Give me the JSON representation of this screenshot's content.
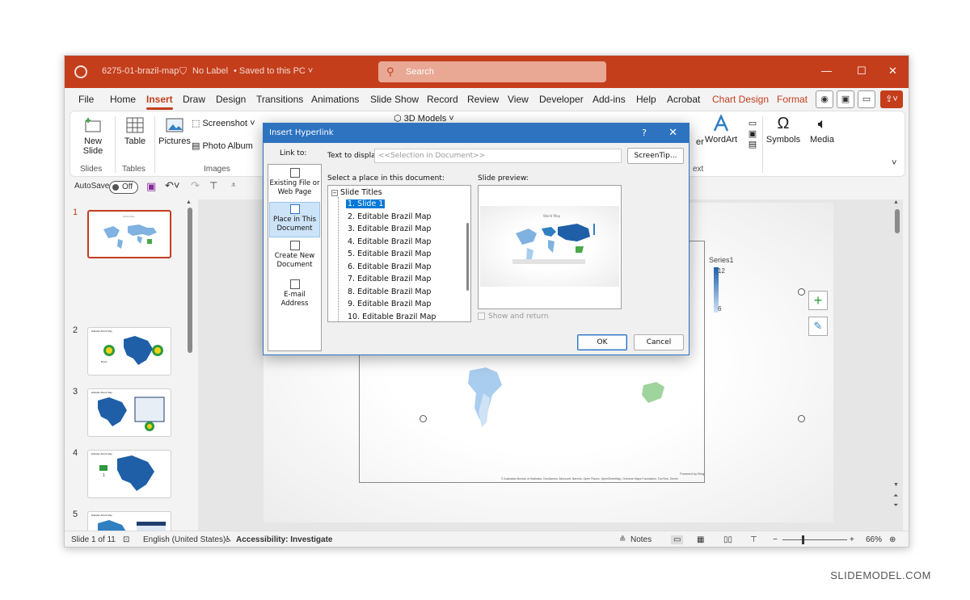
{
  "titlebar": {
    "filename": "6275-01-brazil-map",
    "label": "No Label",
    "saved": "Saved to this PC",
    "search_placeholder": "Search",
    "minimize": "—",
    "maximize": "☐",
    "close": "✕"
  },
  "tabs": [
    "File",
    "Home",
    "Insert",
    "Draw",
    "Design",
    "Transitions",
    "Animations",
    "Slide Show",
    "Record",
    "Review",
    "View",
    "Developer",
    "Add-ins",
    "Help",
    "Acrobat",
    "Chart Design",
    "Format"
  ],
  "active_tab": "Insert",
  "ribbon": {
    "new_slide": "New Slide",
    "table": "Table",
    "pictures": "Pictures",
    "screenshot": "Screenshot",
    "photo_album": "Photo Album",
    "models_3d": "3D Models",
    "wordart": "WordArt",
    "symbols": "Symbols",
    "media": "Media",
    "group_slides": "Slides",
    "group_tables": "Tables",
    "group_images": "Images",
    "partial_er": "er",
    "partial_ext": "ext"
  },
  "qat": {
    "autosave": "AutoSave",
    "autosave_state": "Off"
  },
  "thumbnails": [
    {
      "num": "1",
      "title": ""
    },
    {
      "num": "2",
      "title": "Editable Brazil Map"
    },
    {
      "num": "3",
      "title": "Editable Brazil Map"
    },
    {
      "num": "4",
      "title": "Editable Brazil Map"
    },
    {
      "num": "5",
      "title": "Editable Brazil Map"
    },
    {
      "num": "6",
      "title": ""
    }
  ],
  "thumb_extras": {
    "t1_title": "World Map",
    "t2_caption": "Brazil",
    "t4_num": "1"
  },
  "slide": {
    "legend_title": "Series1",
    "legend_max": "12",
    "legend_min": "6",
    "powered_by": "Powered by Bing",
    "attribution": "© Australian Bureau of Statistics, GeoNames, Microsoft, Navinfo, Open Places, OpenStreetMap, Overture Maps Foundation, TomTom, Zenrin"
  },
  "statusbar": {
    "slide_count": "Slide 1 of 11",
    "language": "English (United States)",
    "accessibility": "Accessibility: Investigate",
    "notes": "Notes",
    "zoom": "66%"
  },
  "dialog": {
    "title": "Insert Hyperlink",
    "help": "?",
    "close": "✕",
    "link_to": "Link to:",
    "link_options": [
      "Existing File or Web Page",
      "Place in This Document",
      "Create New Document",
      "E-mail Address"
    ],
    "text_to_display_label": "Text to display:",
    "text_to_display_value": "<<Selection in Document>>",
    "screentip": "ScreenTip...",
    "select_place_label": "Select a place in this document:",
    "slide_preview_label": "Slide preview:",
    "tree_root": "Slide Titles",
    "tree_items": [
      "1. Slide 1",
      "2. Editable Brazil Map",
      "3. Editable Brazil Map",
      "4. Editable Brazil Map",
      "5. Editable Brazil Map",
      "6. Editable Brazil Map",
      "7. Editable Brazil Map",
      "8. Editable Brazil Map",
      "9. Editable Brazil Map",
      "10. Editable Brazil Map"
    ],
    "preview_title": "World Map",
    "show_and_return": "Show and return",
    "ok": "OK",
    "cancel": "Cancel"
  },
  "watermark": "SLIDEMODEL.COM",
  "colors": {
    "accent": "#c43e1c",
    "dialog_title": "#2e73c0",
    "selection": "#0078d7",
    "map_blue": "#2f7fc1",
    "map_green": "#4aa84a"
  }
}
